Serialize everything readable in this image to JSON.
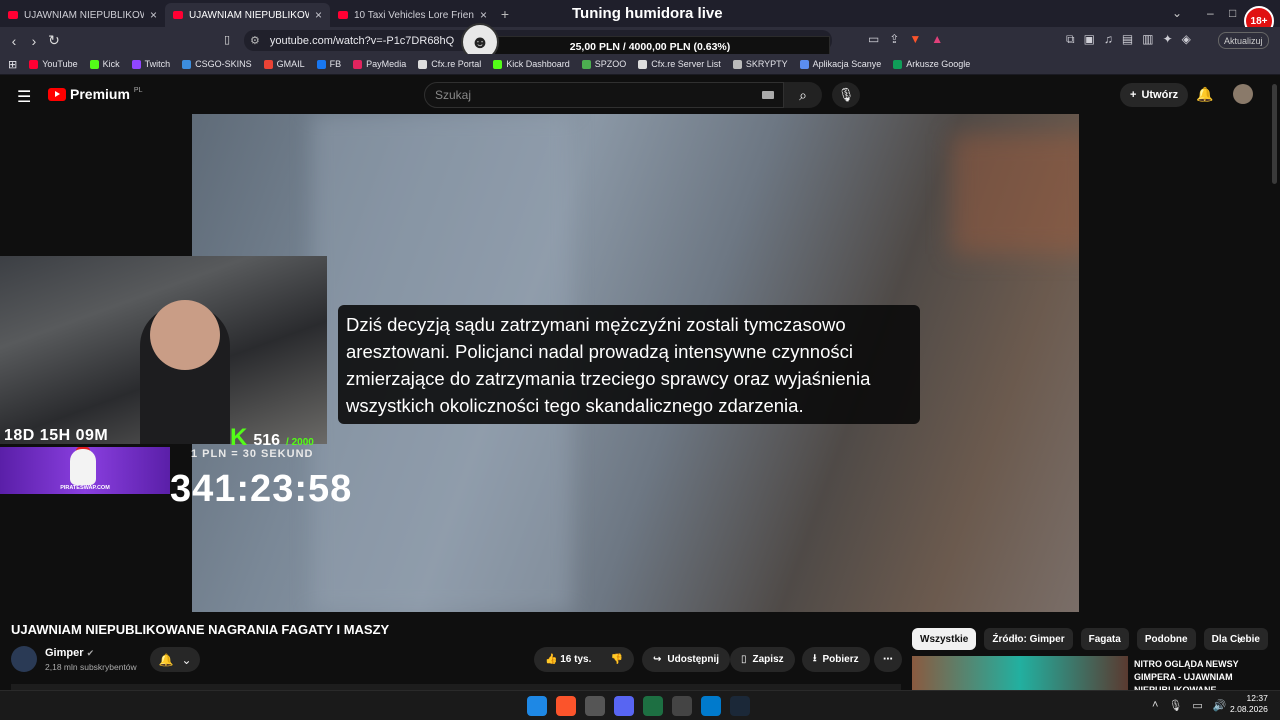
{
  "browser": {
    "tabs": [
      {
        "label": "UJAWNIAM NIEPUBLIKOWANE NAGR",
        "active": false
      },
      {
        "label": "UJAWNIAM NIEPUBLIKOWAN",
        "active": true
      },
      {
        "label": "10 Taxi Vehicles Lore Friendly Cars G",
        "active": false
      }
    ],
    "new_tab": "+",
    "url": "youtube.com/watch?v=-P1c7DR68hQ",
    "update_label": "Aktualizuj",
    "bookmarks": [
      {
        "label": "YouTube",
        "color": "#ff0033"
      },
      {
        "label": "Kick",
        "color": "#53fc18"
      },
      {
        "label": "Twitch",
        "color": "#9146ff"
      },
      {
        "label": "CSGO-SKINS",
        "color": "#3c8dde"
      },
      {
        "label": "GMAIL",
        "color": "#ea4335"
      },
      {
        "label": "FB",
        "color": "#1877f2"
      },
      {
        "label": "PayMedia",
        "color": "#e0245e"
      },
      {
        "label": "Cfx.re Portal",
        "color": "#dddddd"
      },
      {
        "label": "Kick Dashboard",
        "color": "#53fc18"
      },
      {
        "label": "SPZOO",
        "color": "#4caf50"
      },
      {
        "label": "Cfx.re Server List",
        "color": "#dddddd"
      },
      {
        "label": "SKRYPTY",
        "color": "#bbbbbb"
      },
      {
        "label": "Aplikacja Scanye",
        "color": "#5b8def"
      },
      {
        "label": "Arkusze Google",
        "color": "#0f9d58"
      }
    ]
  },
  "stream_overlay": {
    "title": "Tuning humidora live",
    "goal_text": "25,00 PLN / 4000,00 PLN  (0.63%)",
    "age_badge": "18+",
    "uptime": "18D 15H 09M",
    "kick_count": "516",
    "kick_goal": "/ 2000",
    "rate": "1 PLN = 30 SEKUND",
    "big_timer": "341:23:58",
    "ad_brand": "PIRATESWAP.COM"
  },
  "youtube": {
    "logo_text": "Premium",
    "logo_region": "PL",
    "search_placeholder": "Szukaj",
    "create_label": "Utwórz",
    "caption": "Dziś decyzją sądu zatrzymani mężczyźni zostali tymczasowo aresztowani. Policjanci nadal prowadzą intensywne czynności zmierzające do zatrzymania trzeciego sprawcy oraz wyjaśnienia wszystkich okoliczności tego skandalicznego zdarzenia.",
    "video_title": "UJAWNIAM NIEPUBLIKOWANE NAGRANIA FAGATY I MASZY",
    "channel_name": "Gimper",
    "subscribers": "2,18 mln subskrybentów",
    "likes": "16 tys.",
    "share": "Udostępnij",
    "save": "Zapisz",
    "download": "Pobierz",
    "chips": [
      "Wszystkie",
      "Źródło: Gimper",
      "Fagata",
      "Podobne",
      "Dla Ciebie"
    ],
    "rec_title": "NITRO OGLĄDA NEWSY GIMPERA - UJAWNIAM NIEPUBLIKOWANE"
  },
  "taskbar": {
    "time": "12:37",
    "date": "2.08.2026"
  }
}
